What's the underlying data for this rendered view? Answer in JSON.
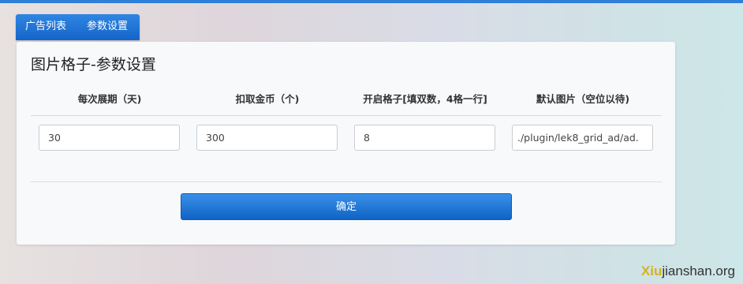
{
  "tabs": [
    {
      "label": "广告列表"
    },
    {
      "label": "参数设置"
    }
  ],
  "panel": {
    "title": "图片格子-参数设置"
  },
  "columns": [
    {
      "header": "每次展期（天)",
      "value": "30"
    },
    {
      "header": "扣取金币（个)",
      "value": "300"
    },
    {
      "header": "开启格子[填双数，4格一行]",
      "value": "8"
    },
    {
      "header": "默认图片（空位以待)",
      "value": "./plugin/lek8_grid_ad/ad."
    }
  ],
  "actions": {
    "confirm_label": "确定"
  },
  "watermark": {
    "prefix": "Xiu",
    "text": "jianshan.org"
  },
  "colors": {
    "accent": "#1565c8",
    "topbar": "#2e7fd8",
    "panel_bg": "#f8f9fb"
  }
}
